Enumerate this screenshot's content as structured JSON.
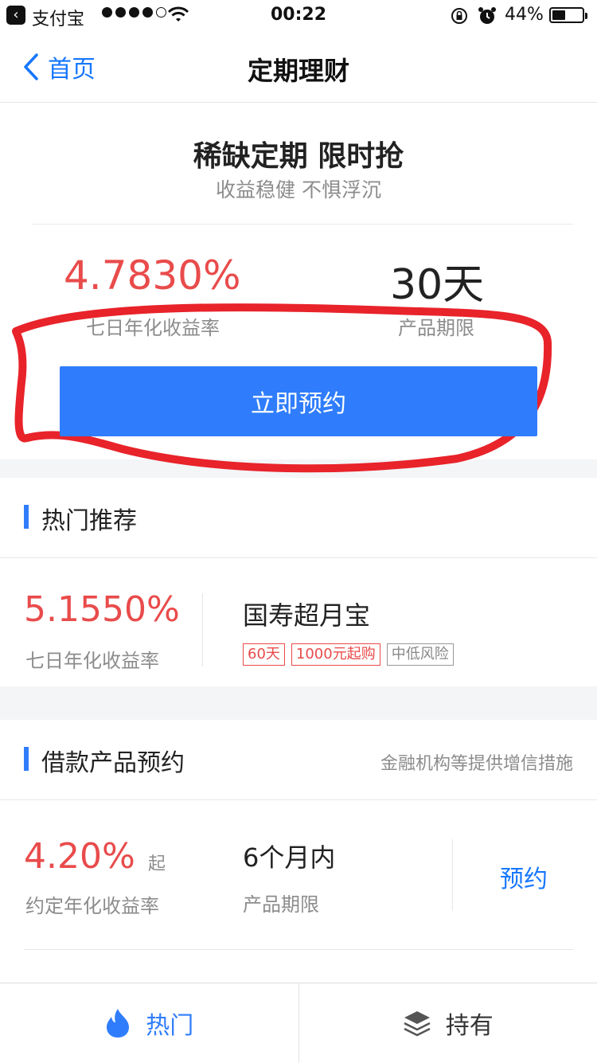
{
  "status_bar": {
    "carrier": "支付宝",
    "time": "00:22",
    "battery": "44%",
    "battery_level": 0.44
  },
  "nav": {
    "back_label": "首页",
    "title": "定期理财"
  },
  "hero": {
    "title": "稀缺定期 限时抢",
    "subtitle": "收益稳健 不惧浮沉",
    "rate": "4.7830%",
    "rate_label": "七日年化收益率",
    "term": "30天",
    "term_label": "产品期限",
    "button_label": "立即预约",
    "highlight_color": "#e8232a"
  },
  "hot": {
    "section_title": "热门推荐",
    "rate": "5.1550%",
    "rate_label": "七日年化收益率",
    "product_name": "国寿超月宝",
    "tags": [
      "60天",
      "1000元起购",
      "中低风险"
    ]
  },
  "loan": {
    "section_title": "借款产品预约",
    "section_note": "金融机构等提供增信措施",
    "rate": "4.20%",
    "rate_suffix": "起",
    "rate_label": "约定年化收益率",
    "term": "6个月内",
    "term_label": "产品期限",
    "button_label": "预约"
  },
  "tabbar": {
    "tabs": [
      {
        "label": "热门",
        "icon": "flame-icon",
        "active": true
      },
      {
        "label": "持有",
        "icon": "layers-icon",
        "active": false
      }
    ]
  },
  "colors": {
    "accent": "#2f7dfc",
    "rate_red": "#e94b4b",
    "link_blue": "#1677ff"
  }
}
